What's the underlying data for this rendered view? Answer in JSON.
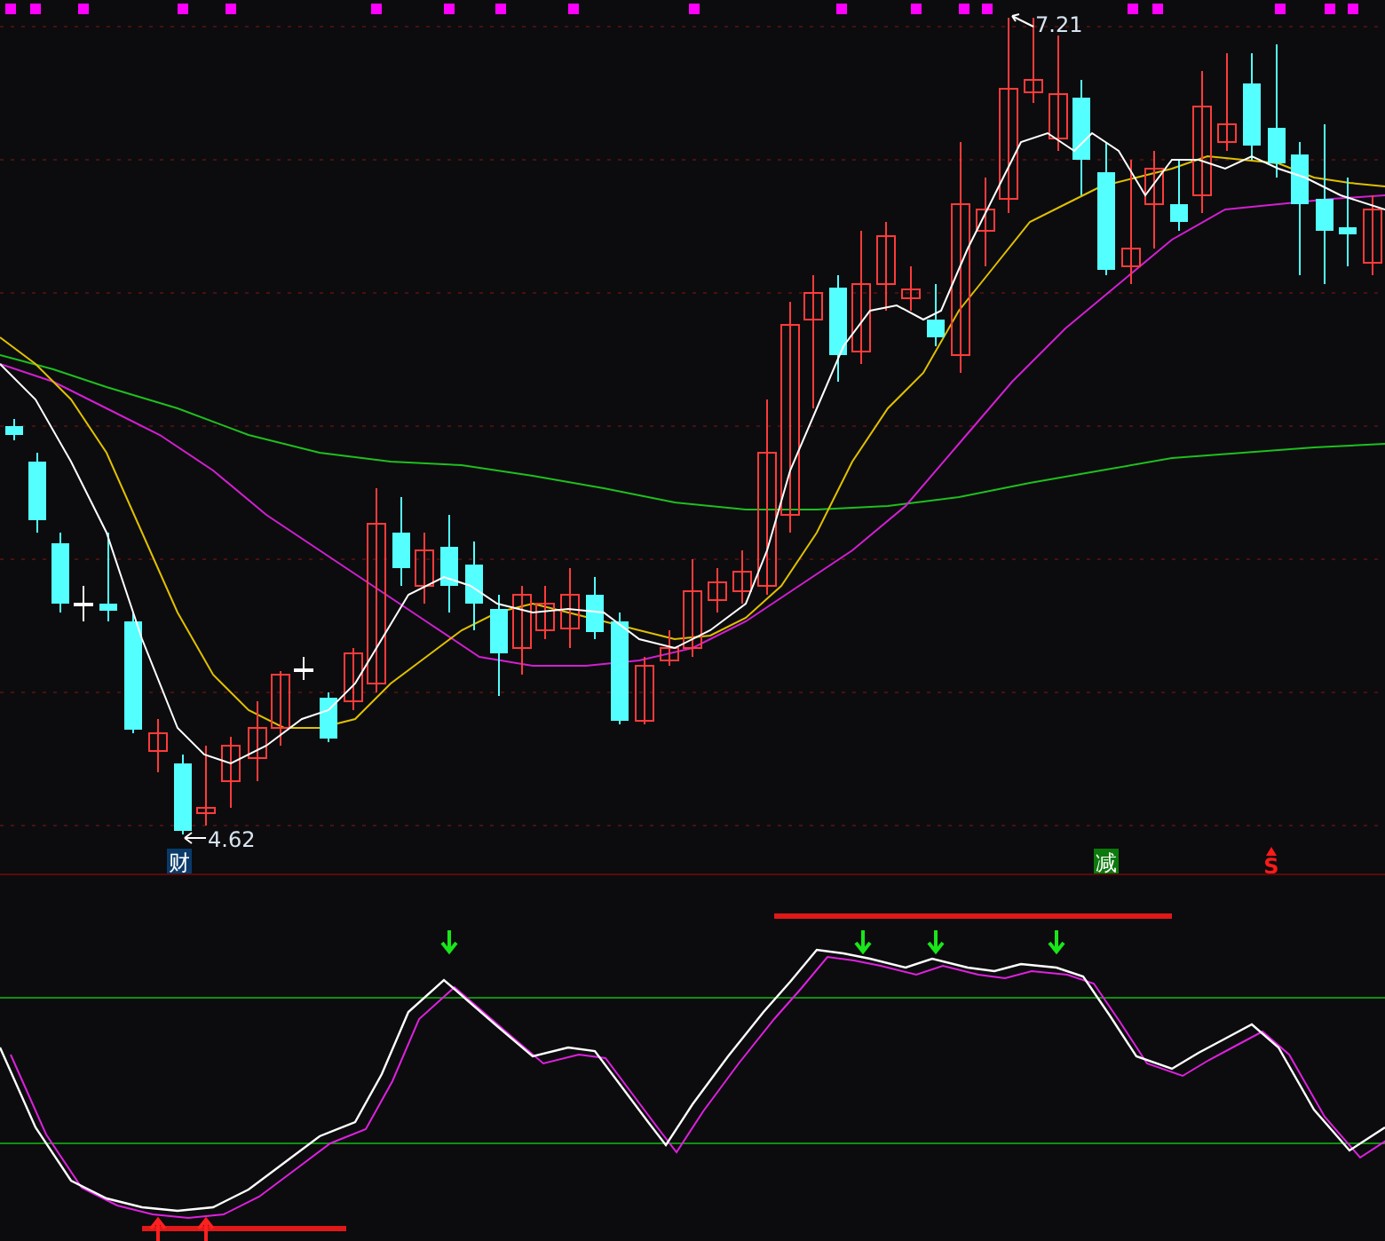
{
  "price_chart": {
    "high_label": "7.21",
    "low_label": "4.62",
    "signals": [
      {
        "kind": "badge",
        "text": "财",
        "color": "#0a3a6a"
      },
      {
        "kind": "badge",
        "text": "减",
        "color": "#0b7a0b"
      },
      {
        "kind": "mark",
        "text": "S",
        "color": "#ff1a1a"
      }
    ]
  }
}
